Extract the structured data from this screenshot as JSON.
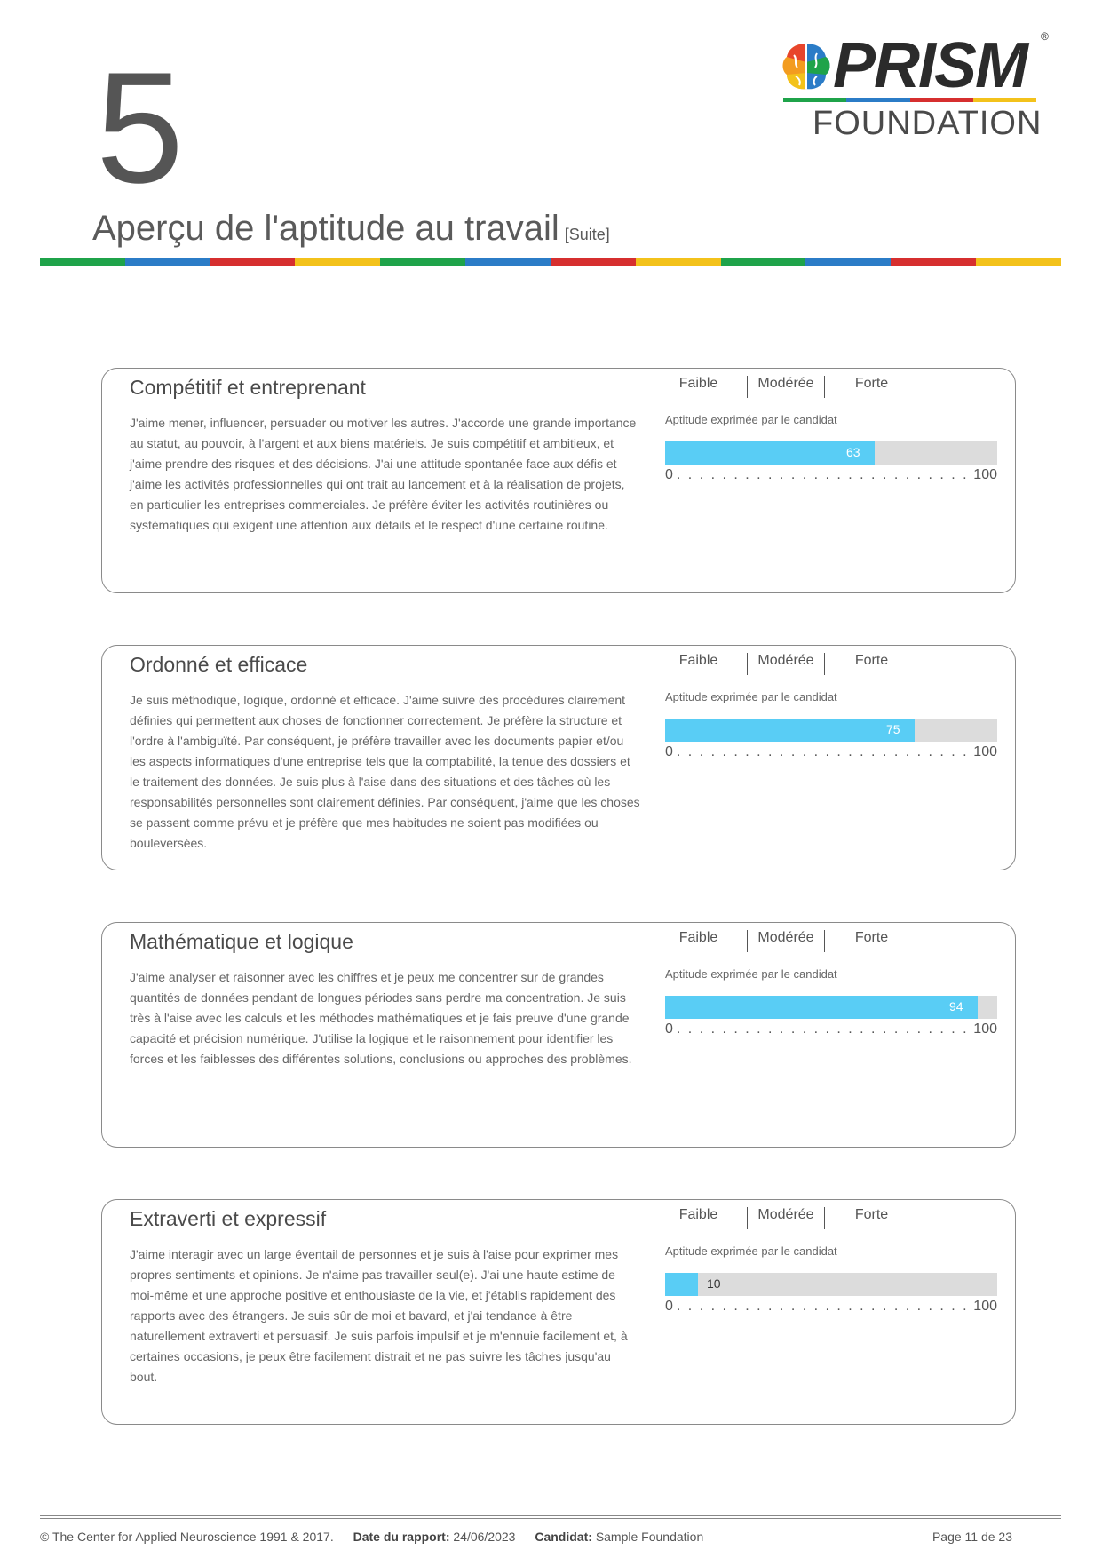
{
  "header": {
    "section_number": "5",
    "section_title": "Aperçu de l'aptitude au travail",
    "section_suffix": "[Suite]"
  },
  "logo": {
    "word": "PRISM",
    "registered": "®",
    "subtitle": "FOUNDATION",
    "underline_colors": [
      "#1fa34a",
      "#2b7cc7",
      "#d62f2f",
      "#f3c21b"
    ]
  },
  "color_bar": [
    "#1fa34a",
    "#2b7cc7",
    "#d62f2f",
    "#f3c21b",
    "#1fa34a",
    "#2b7cc7",
    "#d62f2f",
    "#f3c21b",
    "#1fa34a",
    "#2b7cc7",
    "#d62f2f",
    "#f3c21b"
  ],
  "levels": {
    "low": "Faible",
    "mid": "Modérée",
    "high": "Forte"
  },
  "bar_caption": "Aptitude exprimée par le candidat",
  "scale": {
    "min": "0",
    "max": "100",
    "dots": ". . . . . . . . . . . . . . . . . . . . . . . . . . . . . . . . . . ."
  },
  "cards": [
    {
      "title": "Compétitif et entreprenant",
      "description": "J'aime mener, influencer, persuader ou motiver les autres. J'accorde une grande importance au statut, au pouvoir, à l'argent et aux biens matériels. Je suis compétitif et ambitieux, et j'aime prendre des risques et des décisions. J'ai une attitude spontanée face aux défis et j'aime les activités professionnelles qui ont trait au lancement et à la réalisation de projets, en particulier les entreprises commerciales. Je préfère éviter les activités routinières ou systématiques qui exigent une attention aux détails et le respect d'une certaine routine.",
      "score": 63,
      "score_label": "63"
    },
    {
      "title": "Ordonné et efficace",
      "description": "Je suis méthodique, logique, ordonné et efficace. J'aime suivre des procédures clairement définies qui permettent aux choses de fonctionner correctement. Je préfère la structure et l'ordre à l'ambiguïté. Par conséquent, je préfère travailler avec les documents papier et/ou les aspects informatiques d'une entreprise tels que la comptabilité, la tenue des dossiers et le traitement des données. Je suis plus à l'aise dans des situations et des tâches où les responsabilités personnelles sont clairement définies. Par conséquent, j'aime que les choses se passent comme prévu et je préfère que mes habitudes ne soient pas modifiées ou bouleversées.",
      "score": 75,
      "score_label": "75"
    },
    {
      "title": "Mathématique et logique",
      "description": "J'aime analyser et raisonner avec les chiffres et je peux me concentrer sur de grandes quantités de données pendant de longues périodes sans perdre ma concentration. Je suis très à l'aise avec les calculs et les méthodes mathématiques et je fais preuve d'une grande capacité et précision numérique. J'utilise la logique et le raisonnement pour identifier les forces et les faiblesses des différentes solutions, conclusions ou approches des problèmes.",
      "score": 94,
      "score_label": "94"
    },
    {
      "title": "Extraverti et expressif",
      "description": "J'aime interagir avec un large éventail de personnes et je suis à l'aise pour exprimer mes propres sentiments et opinions. Je n'aime pas travailler seul(e). J'ai une haute estime de moi-même et une approche positive et enthousiaste de la vie, et j'établis rapidement des rapports avec des étrangers. Je suis sûr de moi et bavard, et j'ai tendance à être naturellement extraverti et persuasif. Je suis parfois impulsif et je m'ennuie facilement et, à certaines occasions, je peux être facilement distrait et ne pas suivre les tâches jusqu'au bout.",
      "score": 10,
      "score_label": "10"
    }
  ],
  "footer": {
    "copyright": "© The Center for Applied Neuroscience 1991 & 2017.",
    "date_label": "Date du rapport:",
    "date_value": "24/06/2023",
    "candidate_label": "Candidat:",
    "candidate_value": "Sample Foundation",
    "page": "Page 11 de 23"
  }
}
